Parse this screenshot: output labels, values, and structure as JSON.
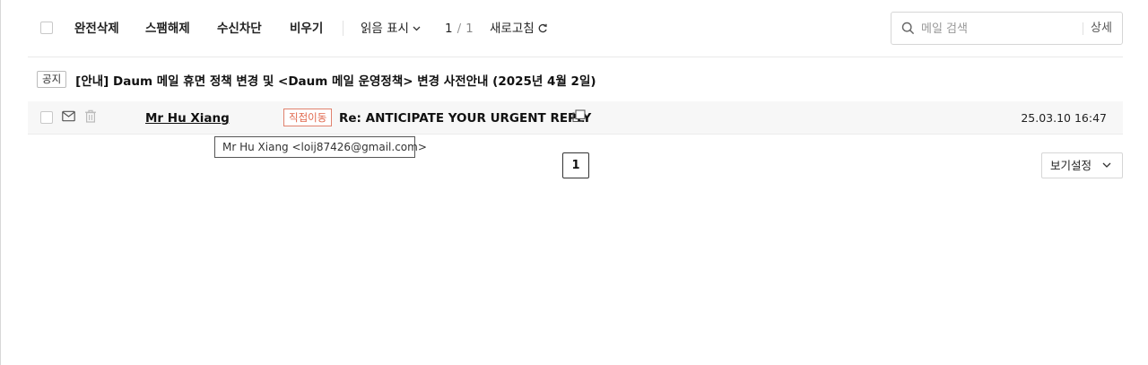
{
  "toolbar": {
    "delete_label": "완전삭제",
    "spam_release_label": "스팸해제",
    "block_label": "수신차단",
    "empty_label": "비우기",
    "read_mark_label": "읽음 표시",
    "pager_current": "1",
    "pager_separator": "/",
    "pager_total": "1",
    "refresh_label": "새로고침"
  },
  "search": {
    "placeholder": "메일 검색",
    "detail_label": "상세"
  },
  "notice": {
    "badge": "공지",
    "text": "[안내] Daum 메일 휴면 정책 변경 및 <Daum 메일 운영정책> 변경 사전안내 (2025년 4월 2일)"
  },
  "mail_list": [
    {
      "sender": "Mr Hu Xiang",
      "move_badge": "직접이동",
      "subject": "Re: ANTICIPATE YOUR URGENT REPLY",
      "date": "25.03.10 16:47"
    }
  ],
  "tooltip": {
    "text": "Mr Hu Xiang <loij87426@gmail.com>"
  },
  "pagination": {
    "current_page": "1"
  },
  "view_settings": {
    "label": "보기설정"
  },
  "colors": {
    "move_badge": "#e0674c",
    "row_background": "#f7f7f7"
  },
  "icons": [
    "checkbox-icon",
    "chevron-down-icon",
    "refresh-icon",
    "search-icon",
    "envelope-icon",
    "trash-icon",
    "copy-icon"
  ]
}
